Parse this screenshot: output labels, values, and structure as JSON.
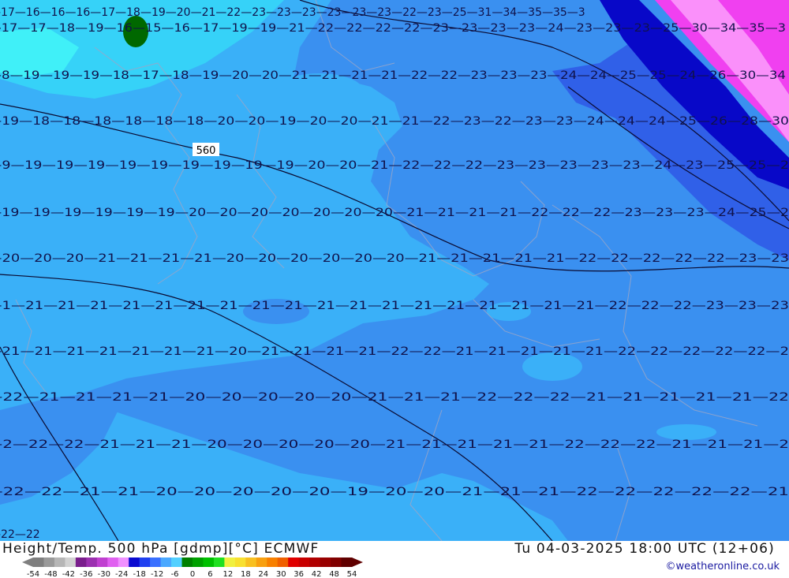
{
  "header": {
    "product": "Height/Temp. 500 hPa [gdmp][°C] ECMWF",
    "valid_time": "Tu 04-03-2025 18:00 UTC (12+06)",
    "credit": "©weatheronline.co.uk"
  },
  "height_contour_label": "560",
  "legend": {
    "ticks": [
      "-54",
      "-48",
      "-42",
      "-36",
      "-30",
      "-24",
      "-18",
      "-12",
      "-6",
      "0",
      "6",
      "12",
      "18",
      "24",
      "30",
      "36",
      "42",
      "48",
      "54"
    ],
    "colors": [
      "#7f7f7f",
      "#9a9a9a",
      "#b6b6b6",
      "#d2d2d2",
      "#7a1e8c",
      "#9c30b0",
      "#c040d0",
      "#e060f0",
      "#f090ff",
      "#0a0ad0",
      "#2040f0",
      "#3a70ff",
      "#4aa8ff",
      "#52d0ff",
      "#008000",
      "#00a000",
      "#00c000",
      "#20e020",
      "#f0f040",
      "#f8e030",
      "#f8c020",
      "#f8a010",
      "#f88000",
      "#f06000",
      "#e00000",
      "#c80000",
      "#b00000",
      "#980000",
      "#800000",
      "#600000"
    ]
  },
  "map_colors": {
    "temp_minus_12_16": "#36d2f8",
    "temp_minus_16_20": "#3ab0f8",
    "temp_minus_20_24": "#3a90f0",
    "temp_minus_24_28": "#3060e8",
    "temp_minus_28_32": "#0808c8",
    "temp_minus_32_36": "#f040f0",
    "temp_minus_36_40": "#fa90fa",
    "temp_minus_8_12": "#40f0f8",
    "warm_spot": "#006800"
  },
  "isotherm_labels": [
    {
      "row": "r0",
      "text": "-17—16—16—16—17—18—19—20—21—22—23—23—23—23—23—23—22—23—25—31—34—35—35—3"
    },
    {
      "row": "r1",
      "text": "-17—17—18—19—16—15—16—17—19—19—21—22—22—22—22—23—23—23—23—24—23—23—23—25—30—34—35—3"
    },
    {
      "row": "r2",
      "text": "-8—19—19—19—18—17—18—19—20—20—21—21—21—21—22—22—23—23—23—24—24—25—25—24—26—30—34"
    },
    {
      "row": "r3",
      "text": "-19—18—18—18—18—18—18—20—20—19—20—20—21—21—22—23—22—23—23—24—24—24—25—26—28—30"
    },
    {
      "row": "r4",
      "text": "-9—19—19—19—19—19—19—19—19—19—20—20—21—22—22—22—23—23—23—23—23—24—23—25—25—2"
    },
    {
      "row": "r5",
      "text": "-19—19—19—19—19—19—20—20—20—20—20—20—20—21—21—21—21—22—22—22—23—23—23—24—25—2"
    },
    {
      "row": "r6",
      "text": "-20—20—20—21—21—21—21—20—20—20—20—20—20—21—21—21—21—21—22—22—22—22—22—23—23"
    },
    {
      "row": "r7",
      "text": "-1—21—21—21—21—21—21—21—21—21—21—21—21—21—21—21—21—21—21—22—22—22—23—23—23"
    },
    {
      "row": "r8",
      "text": "-21—21—21—21—21—21—21—20—21—21—21—21—22—22—21—21—21—21—21—22—22—22—22—22—2"
    },
    {
      "row": "r9",
      "text": "-22—21—21—21—21—20—20—20—20—20—21—21—21—22—22—22—21—21—21—21—21—22"
    },
    {
      "row": "r10",
      "text": "-2—22—22—21—21—21—20—20—20—20—20—21—21—21—21—21—22—22—22—21—21—21—2"
    },
    {
      "row": "r11",
      "text": "-22—22—21—21—20—20—20—20—20—19—20—20—21—21—21—22—22—22—22—22—21"
    },
    {
      "row": "r12",
      "text": "-22—22"
    }
  ]
}
